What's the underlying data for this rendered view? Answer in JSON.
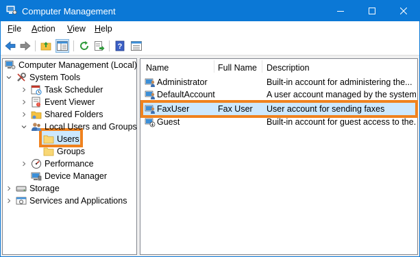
{
  "window": {
    "title": "Computer Management"
  },
  "menubar": {
    "items": [
      {
        "label_ul": "F",
        "label_rest": "ile"
      },
      {
        "label_ul": "A",
        "label_rest": "ction"
      },
      {
        "label_ul": "V",
        "label_rest": "iew"
      },
      {
        "label_ul": "H",
        "label_rest": "elp"
      }
    ]
  },
  "tree": {
    "root": "Computer Management (Local)",
    "system_tools": "System Tools",
    "task_scheduler": "Task Scheduler",
    "event_viewer": "Event Viewer",
    "shared_folders": "Shared Folders",
    "local_users_groups": "Local Users and Groups",
    "users": "Users",
    "groups": "Groups",
    "performance": "Performance",
    "device_manager": "Device Manager",
    "storage": "Storage",
    "services_apps": "Services and Applications"
  },
  "list": {
    "columns": [
      "Name",
      "Full Name",
      "Description"
    ],
    "rows": [
      {
        "name": "Administrator",
        "full_name": "",
        "description": "Built-in account for administering the..."
      },
      {
        "name": "DefaultAccount",
        "full_name": "",
        "description": "A user account managed by the system."
      },
      {
        "name": "FaxUser",
        "full_name": "Fax User",
        "description": "User account for sending faxes"
      },
      {
        "name": "Guest",
        "full_name": "",
        "description": "Built-in account for guest access to the..."
      }
    ]
  },
  "colors": {
    "titlebar": "#0b78d6",
    "highlight": "#f0821e",
    "selection": "#cce8ff"
  }
}
